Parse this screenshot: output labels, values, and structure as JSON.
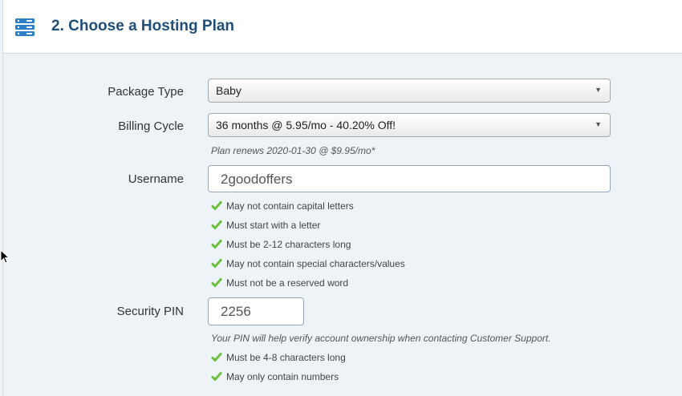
{
  "header": {
    "title": "2. Choose a Hosting Plan",
    "icon": "server-icon"
  },
  "form": {
    "package_type": {
      "label": "Package Type",
      "value": "Baby"
    },
    "billing_cycle": {
      "label": "Billing Cycle",
      "value": "36 months @ 5.95/mo - 40.20% Off!",
      "note": "Plan renews 2020-01-30 @ $9.95/mo*"
    },
    "username": {
      "label": "Username",
      "value": "2goodoffers",
      "rules": [
        "May not contain capital letters",
        "Must start with a letter",
        "Must be 2-12 characters long",
        "May not contain special characters/values",
        "Must not be a reserved word"
      ]
    },
    "security_pin": {
      "label": "Security PIN",
      "value": "2256",
      "note": "Your PIN will help verify account ownership when contacting Customer Support.",
      "rules": [
        "Must be 4-8 characters long",
        "May only contain numbers"
      ]
    }
  },
  "colors": {
    "title": "#1f4f79",
    "icon": "#2b7fc9",
    "check": "#6cbf3f",
    "background": "#eef3f8"
  }
}
